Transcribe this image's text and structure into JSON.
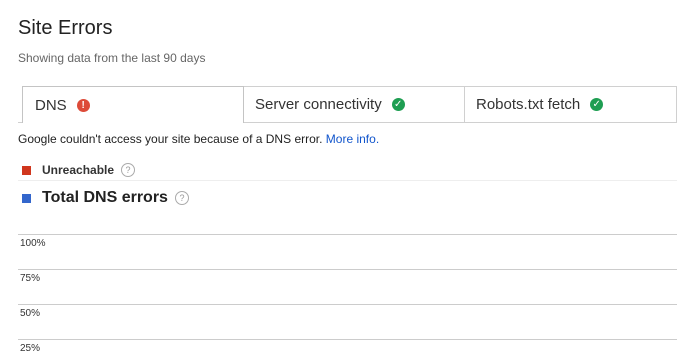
{
  "header": {
    "title": "Site Errors",
    "subtitle": "Showing data from the last 90 days"
  },
  "tabs": [
    {
      "label": "DNS",
      "status": "error",
      "status_icon": "error-icon",
      "active": true
    },
    {
      "label": "Server connectivity",
      "status": "ok",
      "status_icon": "check-icon",
      "active": false
    },
    {
      "label": "Robots.txt fetch",
      "status": "ok",
      "status_icon": "check-icon",
      "active": false
    }
  ],
  "message": {
    "text": "Google couldn't access your site because of a DNS error.",
    "link": "More info."
  },
  "legend": [
    {
      "label": "Unreachable",
      "color": "#d0361d",
      "help_icon": "help-icon"
    },
    {
      "label": "Total DNS errors",
      "color": "#3366cc",
      "help_icon": "help-icon"
    }
  ],
  "colors": {
    "error": "#dd4b39",
    "ok": "#1e9e52",
    "link": "#1155cc"
  },
  "chart_data": {
    "type": "line",
    "title": "",
    "xlabel": "",
    "ylabel": "",
    "y_tick_labels": [
      "100%",
      "75%",
      "50%",
      "25%"
    ],
    "y_ticks": [
      100,
      75,
      50,
      25
    ],
    "grid": true,
    "series": []
  }
}
